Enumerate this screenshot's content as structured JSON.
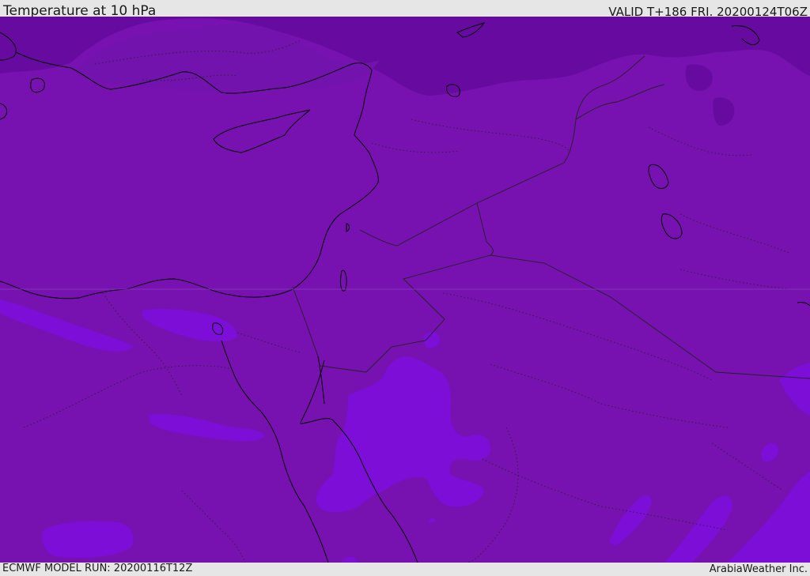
{
  "header": {
    "title": "Temperature at 10 hPa",
    "valid_time": "VALID T+186 FRI. 20200124T06Z"
  },
  "footer": {
    "model_run": "ECMWF MODEL RUN: 20200116T12Z",
    "credit": "ArabiaWeather Inc."
  },
  "map": {
    "field": "temperature",
    "level": "10 hPa",
    "colors": {
      "base_band": "#7711b0",
      "cold_band": "#660aa0",
      "warm_band": "#7c0ed8",
      "coastline": "#000000",
      "borders": "#222222"
    }
  }
}
